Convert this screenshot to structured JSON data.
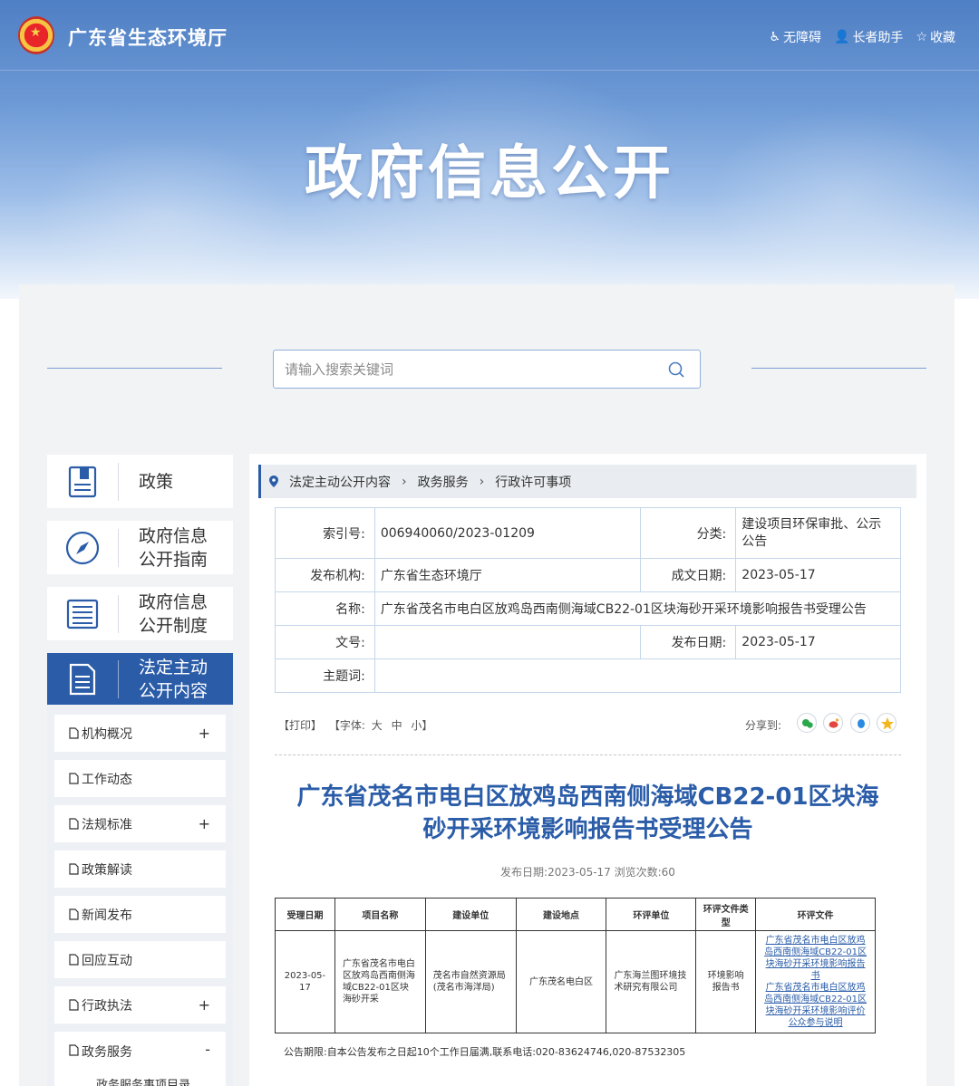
{
  "header": {
    "site_name": "广东省生态环境厅",
    "links": [
      {
        "icon": "accessibility-icon",
        "label": "无障碍"
      },
      {
        "icon": "elder-helper-icon",
        "label": "长者助手"
      },
      {
        "icon": "star-icon",
        "label": "收藏"
      }
    ]
  },
  "banner": {
    "title": "政府信息公开"
  },
  "search": {
    "placeholder": "请输入搜索关键词",
    "value": ""
  },
  "sidebar": {
    "cards": [
      {
        "label": "政策",
        "icon": "book-icon"
      },
      {
        "label": "政府信息公开指南",
        "line1": "政府信息",
        "line2": "公开指南",
        "icon": "compass-icon"
      },
      {
        "label": "政府信息公开制度",
        "line1": "政府信息",
        "line2": "公开制度",
        "icon": "list-icon"
      },
      {
        "label": "法定主动公开内容",
        "line1": "法定主动",
        "line2": "公开内容",
        "icon": "document-icon",
        "active": true
      }
    ],
    "sub_items": [
      {
        "label": "机构概况",
        "toggle": "+"
      },
      {
        "label": "工作动态",
        "toggle": ""
      },
      {
        "label": "法规标准",
        "toggle": "+"
      },
      {
        "label": "政策解读",
        "toggle": ""
      },
      {
        "label": "新闻发布",
        "toggle": ""
      },
      {
        "label": "回应互动",
        "toggle": ""
      },
      {
        "label": "行政执法",
        "toggle": "+"
      },
      {
        "label": "政务服务",
        "toggle": "-"
      }
    ],
    "sub_sub_item": "政务服务事项目录"
  },
  "breadcrumb": [
    "法定主动公开内容",
    "政务服务",
    "行政许可事项"
  ],
  "meta": {
    "index_label": "索引号:",
    "index_value": "006940060/2023-01209",
    "category_label": "分类:",
    "category_value_line1": "建设项目环保审批、公示",
    "category_value_line2": "公告",
    "publisher_label": "发布机构:",
    "publisher_value": "广东省生态环境厅",
    "created_label": "成文日期:",
    "created_value": "2023-05-17",
    "name_label": "名称:",
    "name_value": "广东省茂名市电白区放鸡岛西南侧海域CB22-01区块海砂开采环境影响报告书受理公告",
    "docno_label": "文号:",
    "docno_value": "",
    "pubdate_label": "发布日期:",
    "pubdate_value": "2023-05-17",
    "keywords_label": "主题词:",
    "keywords_value": ""
  },
  "tools": {
    "print": "【打印】",
    "font_prefix": "【字体:",
    "font_large": "大",
    "font_medium": "中",
    "font_small": "小】",
    "share_label": "分享到:"
  },
  "article": {
    "title_line1": "广东省茂名市电白区放鸡岛西南侧海域CB22-01区块海",
    "title_line2": "砂开采环境影响报告书受理公告",
    "pub_info": "发布日期:2023-05-17  浏览次数:60"
  },
  "table": {
    "headers": [
      "受理日期",
      "项目名称",
      "建设单位",
      "建设地点",
      "环评单位",
      "环评文件类型",
      "环评文件"
    ],
    "row": {
      "date": "2023-05-17",
      "project": "广东省茂名市电白区放鸡岛西南侧海域CB22-01区块海砂开采",
      "builder": "茂名市自然资源局(茂名市海洋局)",
      "location": "广东茂名电白区",
      "eia_unit": "广东海兰图环境技术研究有限公司",
      "doc_type": "环境影响报告书",
      "doc_links": [
        "广东省茂名市电白区放鸡岛西南侧海域CB22-01区块海砂开采环境影响报告书",
        "广东省茂名市电白区放鸡岛西南侧海域CB22-01区块海砂开采环境影响评价公众参与说明"
      ]
    }
  },
  "notice": "公告期限:自本公告发布之日起10个工作日届满,联系电话:020-83624746,020-87532305",
  "colors": {
    "accent": "#2a5ca8",
    "banner_top": "#4f7fc4",
    "panel_bg": "#f2f3f5"
  }
}
